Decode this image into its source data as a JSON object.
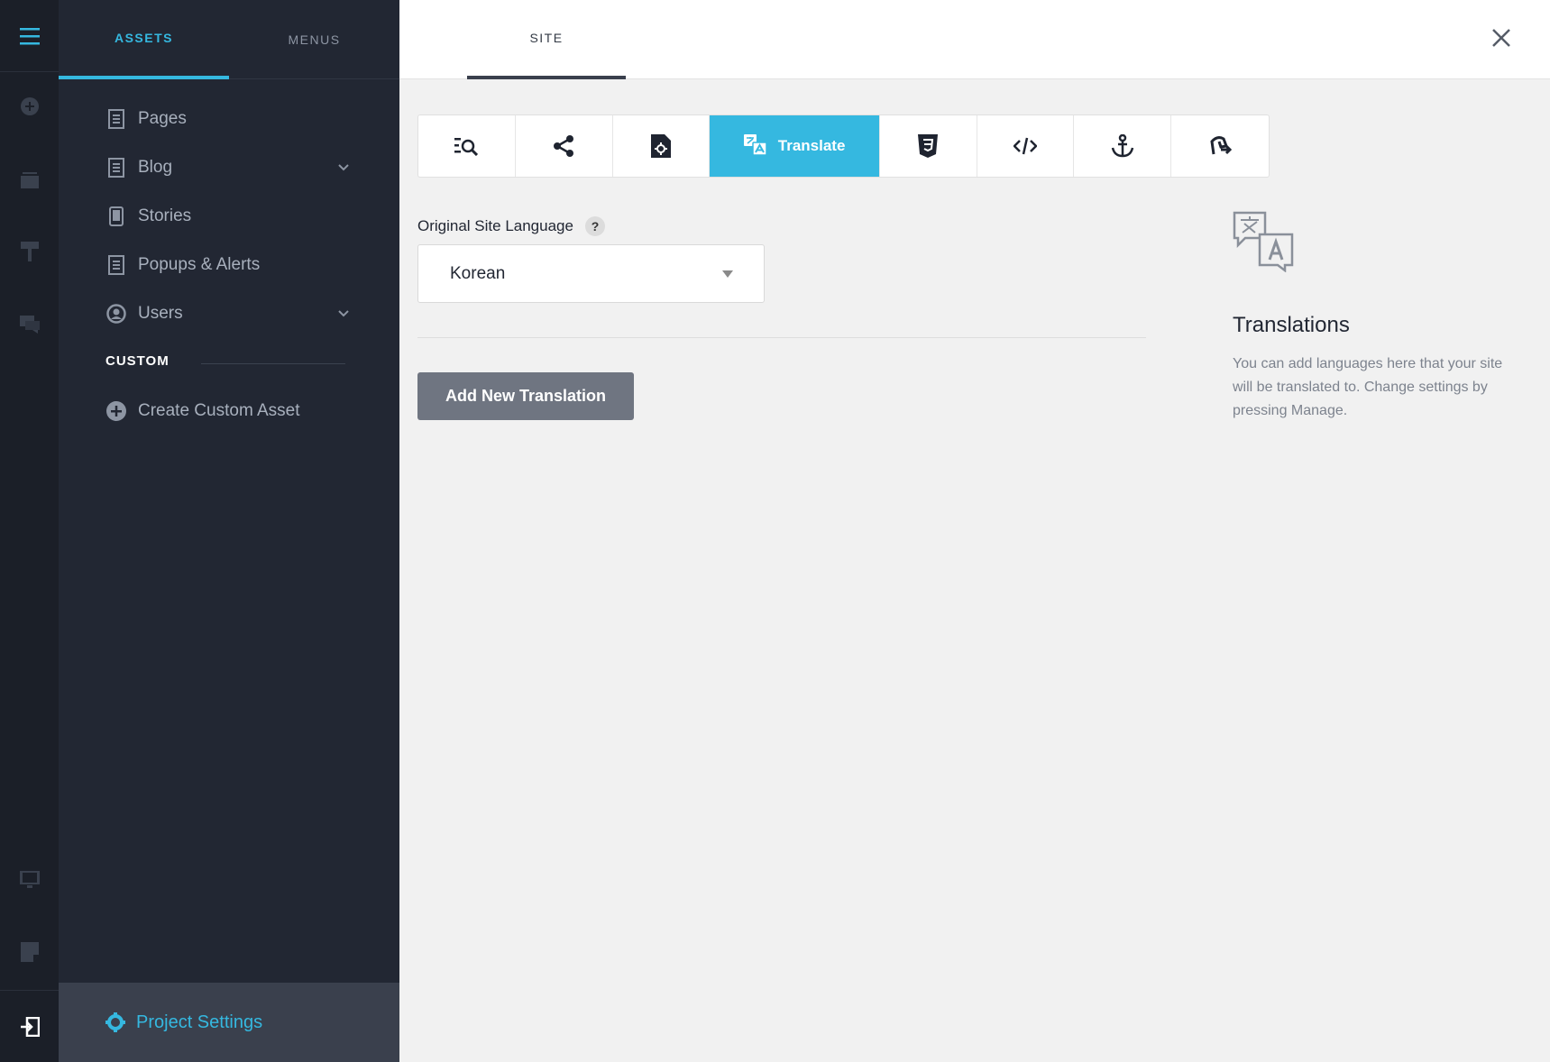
{
  "colors": {
    "accent": "#35b8e0",
    "rail": "#1b1f28",
    "panel": "#222733",
    "button": "#6f7581"
  },
  "panel": {
    "tabs": [
      {
        "label": "ASSETS"
      },
      {
        "label": "MENUS"
      }
    ],
    "items": [
      {
        "label": "Pages",
        "icon": "page-icon"
      },
      {
        "label": "Blog",
        "icon": "page-icon"
      },
      {
        "label": "Stories",
        "icon": "phone-icon"
      },
      {
        "label": "Popups & Alerts",
        "icon": "page-icon"
      },
      {
        "label": "Users",
        "icon": "user-circle-icon"
      }
    ],
    "custom_heading": "CUSTOM",
    "create_custom": "Create Custom Asset",
    "project_settings": "Project Settings"
  },
  "header": {
    "tab": "SITE"
  },
  "toolbar": {
    "active_label": "Translate"
  },
  "form": {
    "language_label": "Original Site Language",
    "help": "?",
    "language_value": "Korean",
    "add_button": "Add New Translation"
  },
  "info": {
    "title": "Translations",
    "body": "You can add languages here that your site will be translated to. Change settings by pressing Manage."
  }
}
